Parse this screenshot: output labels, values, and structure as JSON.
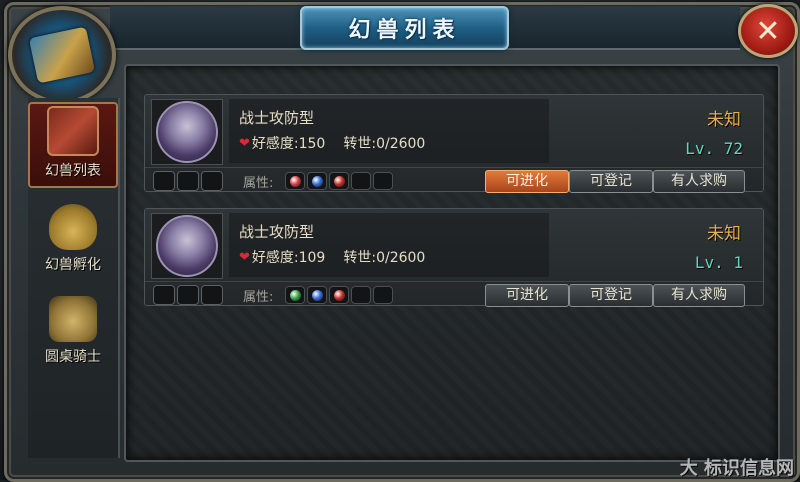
{
  "window": {
    "title": "幻兽列表",
    "close_glyph": "✕"
  },
  "sidebar": {
    "items": [
      {
        "label": "幻兽列表",
        "icon": "scroll-icon",
        "active": true
      },
      {
        "label": "幻兽孵化",
        "icon": "egg-icon",
        "active": false
      },
      {
        "label": "圆桌骑士",
        "icon": "crossed-swords-icon",
        "active": false
      }
    ]
  },
  "pets": [
    {
      "class_name": "战士攻防型",
      "affinity_label": "好感度:150",
      "rebirth_label": "转世:0/2600",
      "status": "未知",
      "level": "Lv. 72",
      "attr_label": "属性:",
      "gem_colors": [
        "#d8404a",
        "#3a6fd8",
        "#c8322a"
      ],
      "buttons": {
        "evolve": "可进化",
        "register": "可登记",
        "request": "有人求购"
      },
      "evolve_highlight": true
    },
    {
      "class_name": "战士攻防型",
      "affinity_label": "好感度:109",
      "rebirth_label": "转世:0/2600",
      "status": "未知",
      "level": "Lv. 1",
      "attr_label": "属性:",
      "gem_colors": [
        "#3aa84a",
        "#3a6fd8",
        "#c8322a"
      ],
      "buttons": {
        "evolve": "可进化",
        "register": "可登记",
        "request": "有人求购"
      },
      "evolve_highlight": false
    }
  ],
  "watermark": "大 标识信息网",
  "colors": {
    "accent_orange": "#e27a3a",
    "level_teal": "#5ed8c4",
    "status_gold": "#e8b04a",
    "title_blue": "#1f5f86"
  }
}
